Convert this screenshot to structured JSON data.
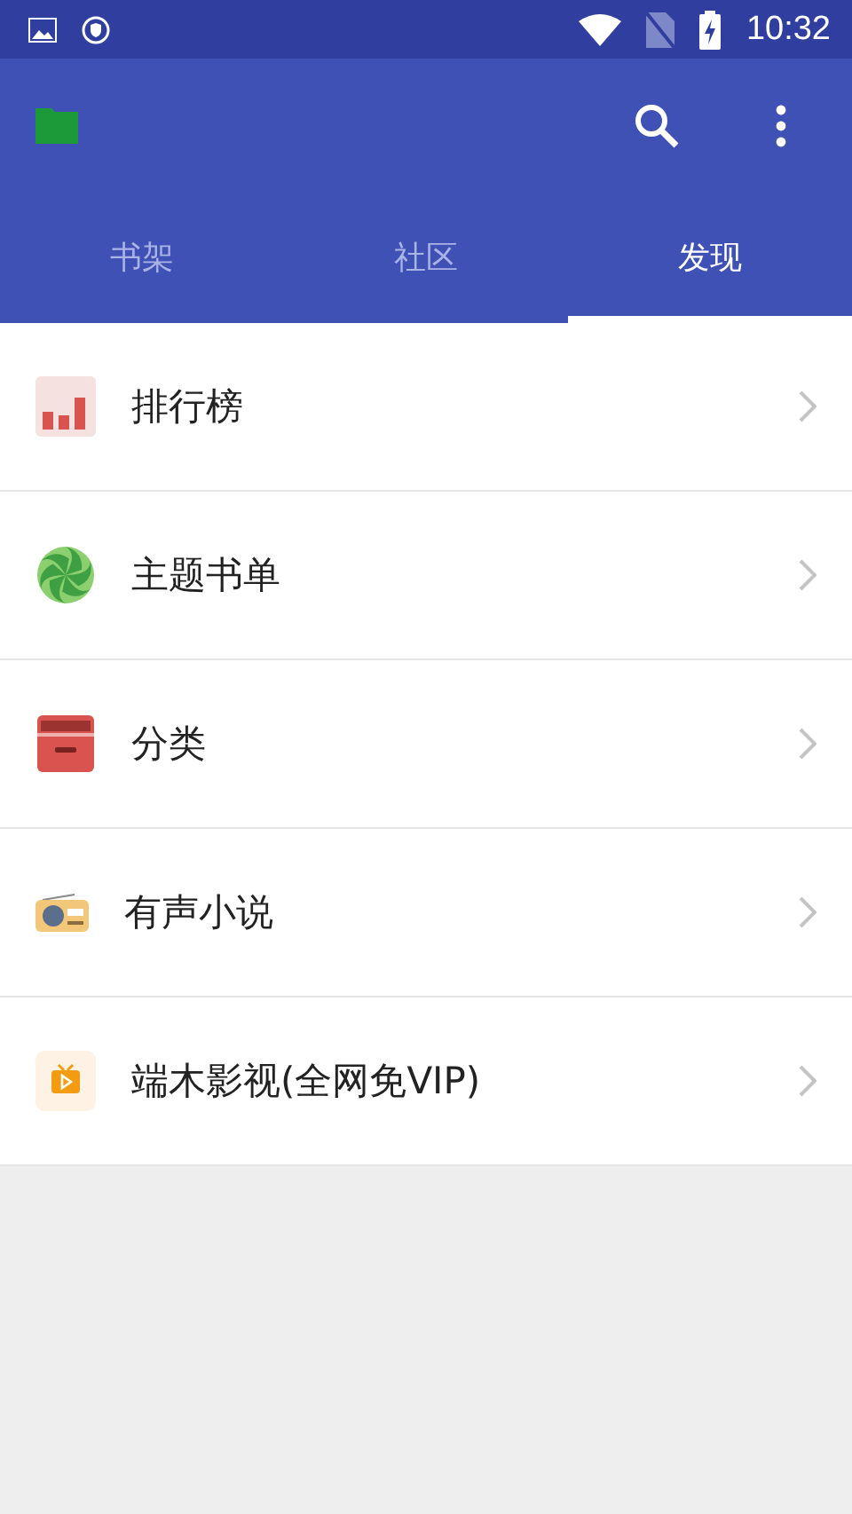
{
  "status_bar": {
    "time": "10:32"
  },
  "tabs": [
    {
      "label": "书架",
      "selected": false
    },
    {
      "label": "社区",
      "selected": false
    },
    {
      "label": "发现",
      "selected": true
    }
  ],
  "items": [
    {
      "kind": "chart",
      "label": "排行榜"
    },
    {
      "kind": "candy",
      "label": "主题书单"
    },
    {
      "kind": "drawer",
      "label": "分类"
    },
    {
      "kind": "radio",
      "label": "有声小说"
    },
    {
      "kind": "tv",
      "label": "端木影视(全网免VIP)"
    }
  ]
}
